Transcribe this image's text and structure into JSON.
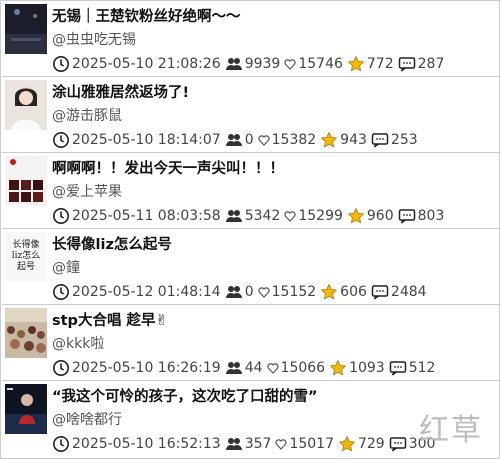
{
  "posts": [
    {
      "title": "无锡｜王楚钦粉丝好绝啊～～",
      "author": "@虫虫吃无锡",
      "datetime": "2025-05-10 21:08:26",
      "views": "9939",
      "likes": "15746",
      "stars": "772",
      "comments": "287",
      "thumb": "dark-stage-photo"
    },
    {
      "title": "涂山雅雅居然返场了!",
      "author": "@游击豚鼠",
      "datetime": "2025-05-10 18:14:07",
      "views": "0",
      "likes": "15382",
      "stars": "943",
      "comments": "253",
      "thumb": "portrait-photo"
    },
    {
      "title": "啊啊啊！！发出今天一声尖叫！！！",
      "author": "@爱上苹果",
      "datetime": "2025-05-11 08:03:58",
      "views": "5342",
      "likes": "15299",
      "stars": "960",
      "comments": "803",
      "thumb": "poster-grid"
    },
    {
      "title": "长得像liz怎么起号",
      "author": "@鐘",
      "datetime": "2025-05-12 01:48:14",
      "views": "0",
      "likes": "15152",
      "stars": "606",
      "comments": "2484",
      "thumb_text": [
        "长得像",
        "liz怎么",
        "起号"
      ]
    },
    {
      "title": "stp大合唱 趁早✌",
      "author": "@kkk啦",
      "datetime": "2025-05-10 16:26:19",
      "views": "44",
      "likes": "15066",
      "stars": "1093",
      "comments": "512",
      "thumb": "crowd-photo"
    },
    {
      "title": "“我这个可怜的孩子，这次吃了口甜的雪”",
      "author": "@啥啥都行",
      "datetime": "2025-05-10 16:52:13",
      "views": "357",
      "likes": "15017",
      "stars": "729",
      "comments": "300",
      "thumb": "stage-performer-photo"
    }
  ],
  "watermark": "红草",
  "icons": {
    "clock": "clock-icon",
    "views": "people-icon",
    "likes": "heart-icon",
    "stars": "star-icon",
    "comments": "comment-icon"
  },
  "colors": {
    "border": "#c9cdd3",
    "star": "#f2b705",
    "text_secondary": "#555555"
  }
}
